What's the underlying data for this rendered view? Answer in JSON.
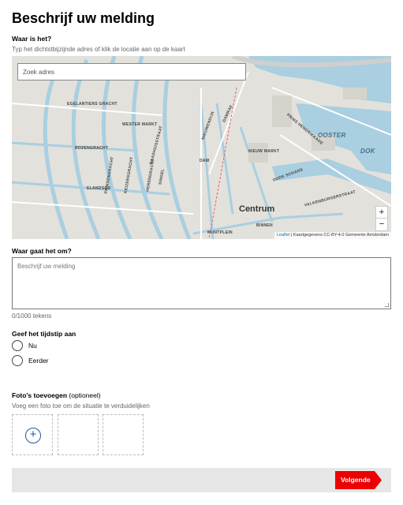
{
  "page": {
    "title": "Beschrijf uw melding"
  },
  "location": {
    "label": "Waar is het?",
    "hint": "Typ het dichtstbijzijnde adres of klik de locatie aan op de kaart",
    "search_placeholder": "Zoek adres",
    "zoom_in": "+",
    "zoom_out": "−",
    "attribution_link": "Leaflet",
    "attribution_text": "| Kaartgegevens CC-BY-4.0 Gemeente Amsterdam",
    "map_labels": {
      "westermarkt": "WESTER MARKT",
      "nieuwmarkt": "NIEUW MARKT",
      "centrum": "Centrum",
      "oosterdok": "OOSTER",
      "dok": "DOK",
      "dam": "DAM",
      "rozengracht": "ROZENGRACHT",
      "elandsgr": "ELANDSGR",
      "prinsengracht": "PRINSENGRACHT",
      "keizersgracht": "KEIZERSGRACHT",
      "herengracht": "HERENGRACHT",
      "singel": "SINGEL",
      "raadhuisstraat": "RAADHUISSTRAAT",
      "nieuwendijk": "NIEUWENDIJK",
      "damrak": "DAMRAK",
      "muntplein": "MUNTPLEIN",
      "binnen": "BINNEN",
      "oudeschans": "OUDE SCHANS",
      "valkenburgerstraat": "VALKENBURGERSTRAAT",
      "prinshendrikkade": "PRINS HENDRIKKADE",
      "egelantiersgracht": "EGELANTIERS GRACHT"
    }
  },
  "description": {
    "label": "Waar gaat het om?",
    "placeholder": "Beschrijf uw melding",
    "counter": "0/1000 tekens"
  },
  "time": {
    "label": "Geef het tijdstip aan",
    "options": [
      "Nu",
      "Eerder"
    ]
  },
  "photos": {
    "label": "Foto's toevoegen",
    "optional": "(optioneel)",
    "hint": "Voeg een foto toe om de situatie te verduidelijken",
    "add_glyph": "+"
  },
  "footer": {
    "next_label": "Volgende"
  },
  "colors": {
    "accent_red": "#ec0000",
    "water": "#a9cfe0",
    "land": "#e3e1dc",
    "add_icon_blue": "#1f5aa0",
    "footer_bg": "#e6e6e6"
  }
}
